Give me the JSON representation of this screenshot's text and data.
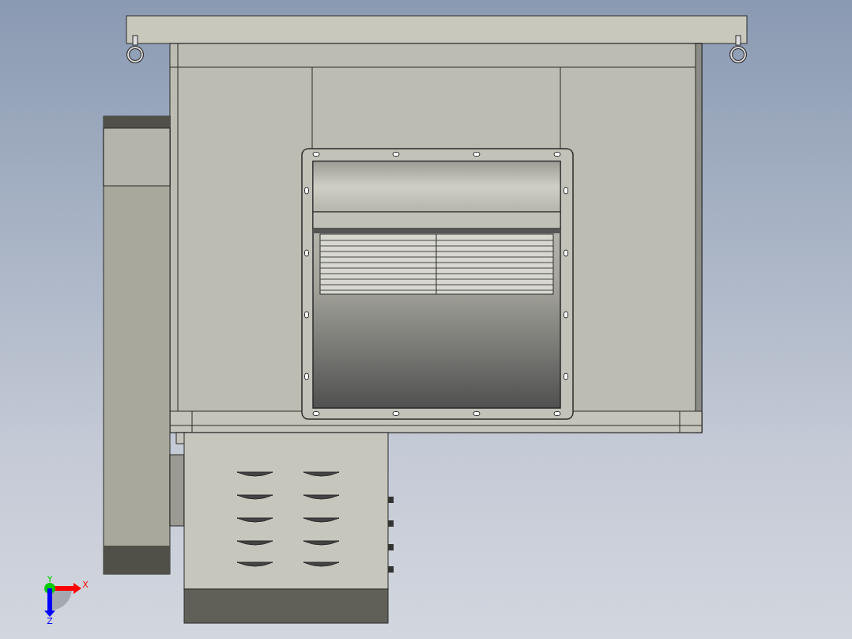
{
  "viewport": {
    "triad": {
      "axes": [
        {
          "label": "X",
          "color": "#ff0000",
          "kind": "right"
        },
        {
          "label": "Y",
          "color": "#00cc00",
          "kind": "toward"
        },
        {
          "label": "Z",
          "color": "#0000ff",
          "kind": "down"
        }
      ]
    }
  }
}
